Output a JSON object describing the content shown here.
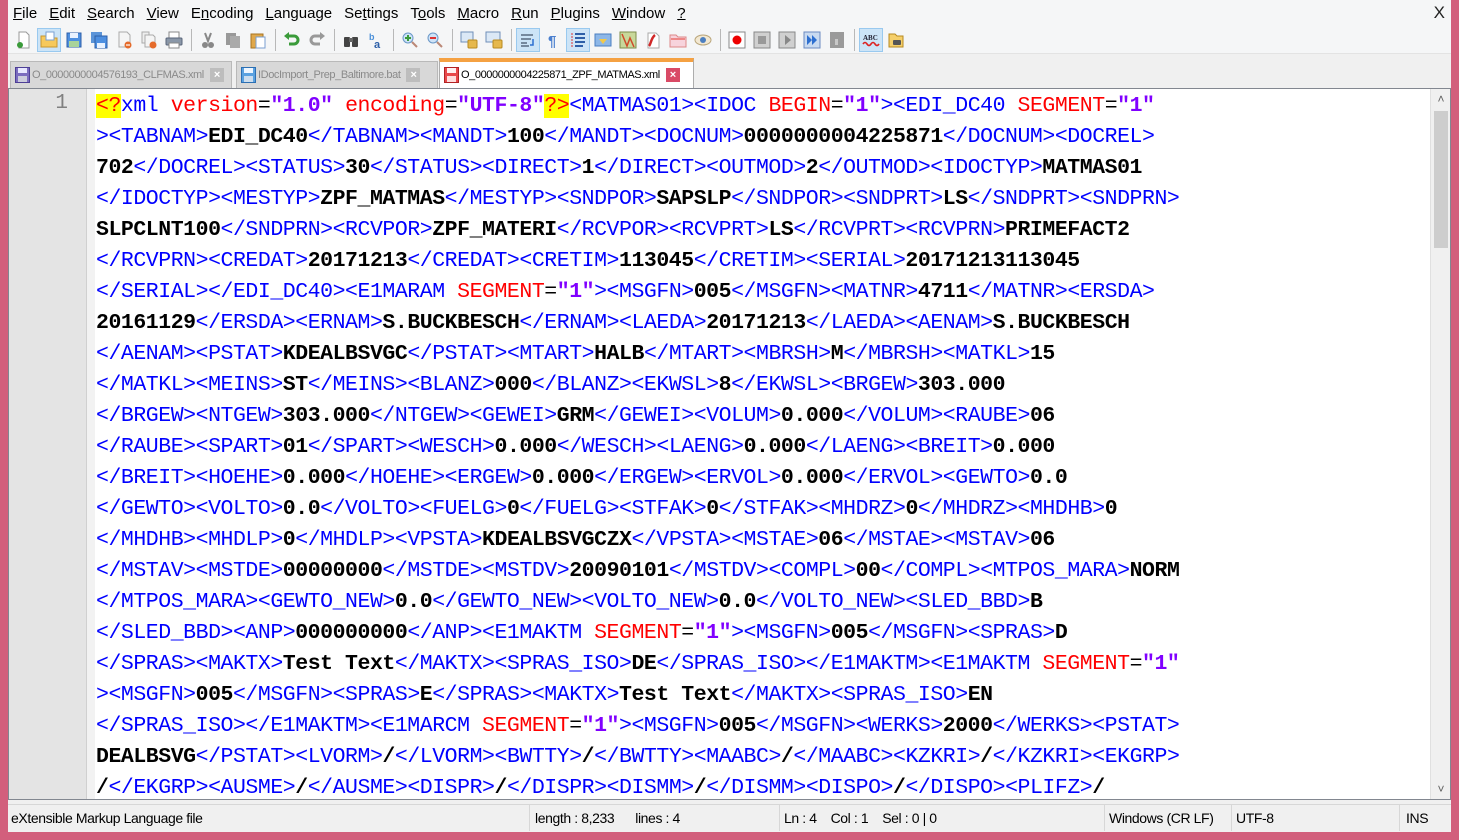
{
  "window": {
    "close_label": "X"
  },
  "menu": [
    {
      "label": "File",
      "accel": "F",
      "rest": "ile"
    },
    {
      "label": "Edit",
      "accel": "E",
      "rest": "dit"
    },
    {
      "label": "Search",
      "accel": "S",
      "rest": "earch"
    },
    {
      "label": "View",
      "accel": "V",
      "rest": "iew"
    },
    {
      "label": "Encoding",
      "pre": "E",
      "accel": "n",
      "rest": "coding"
    },
    {
      "label": "Language",
      "accel": "L",
      "rest": "anguage"
    },
    {
      "label": "Settings",
      "pre": "Se",
      "accel": "t",
      "rest": "tings"
    },
    {
      "label": "Tools",
      "pre": "T",
      "accel": "o",
      "rest": "ols"
    },
    {
      "label": "Macro",
      "accel": "M",
      "rest": "acro"
    },
    {
      "label": "Run",
      "accel": "R",
      "rest": "un"
    },
    {
      "label": "Plugins",
      "accel": "P",
      "rest": "lugins"
    },
    {
      "label": "Window",
      "accel": "W",
      "rest": "indow"
    },
    {
      "label": "?",
      "accel": "?",
      "rest": ""
    }
  ],
  "toolbar": {
    "buttons": [
      {
        "name": "new-file",
        "icon": "new-file-icon"
      },
      {
        "name": "open-file",
        "icon": "open-folder-icon",
        "active": true
      },
      {
        "name": "save",
        "icon": "save-icon"
      },
      {
        "name": "save-all",
        "icon": "save-all-icon"
      },
      {
        "name": "close",
        "icon": "close-file-icon"
      },
      {
        "name": "close-all",
        "icon": "close-all-icon"
      },
      {
        "name": "print",
        "icon": "print-icon"
      },
      {
        "sep": true
      },
      {
        "name": "cut",
        "icon": "cut-icon"
      },
      {
        "name": "copy",
        "icon": "copy-icon"
      },
      {
        "name": "paste",
        "icon": "paste-icon"
      },
      {
        "sep": true
      },
      {
        "name": "undo",
        "icon": "undo-icon"
      },
      {
        "name": "redo",
        "icon": "redo-icon"
      },
      {
        "sep": true
      },
      {
        "name": "find",
        "icon": "binoculars-icon"
      },
      {
        "name": "replace",
        "icon": "replace-icon"
      },
      {
        "sep": true
      },
      {
        "name": "zoom-in",
        "icon": "zoom-in-icon"
      },
      {
        "name": "zoom-out",
        "icon": "zoom-out-icon"
      },
      {
        "sep": true
      },
      {
        "name": "sync-vertical",
        "icon": "sync-vertical-icon"
      },
      {
        "name": "sync-horizontal",
        "icon": "sync-horizontal-icon"
      },
      {
        "sep": true
      },
      {
        "name": "word-wrap",
        "icon": "word-wrap-icon",
        "active": true
      },
      {
        "name": "show-all-chars",
        "icon": "pilcrow-icon"
      },
      {
        "name": "indent-guide",
        "icon": "indent-guide-icon",
        "active": true
      },
      {
        "name": "user-defined-language",
        "icon": "udl-icon"
      },
      {
        "name": "document-map",
        "icon": "document-map-icon"
      },
      {
        "name": "function-list",
        "icon": "function-list-icon"
      },
      {
        "name": "folder-as-workspace",
        "icon": "folder-icon"
      },
      {
        "name": "monitoring",
        "icon": "eye-icon"
      },
      {
        "sep": true
      },
      {
        "name": "record-macro",
        "icon": "record-icon"
      },
      {
        "name": "stop-recording",
        "icon": "stop-icon"
      },
      {
        "name": "play-macro",
        "icon": "play-icon"
      },
      {
        "name": "run-macro-multiple",
        "icon": "fast-forward-icon"
      },
      {
        "name": "save-macro",
        "icon": "save-macro-icon"
      },
      {
        "sep": true
      },
      {
        "name": "spell-check",
        "icon": "spell-check-icon",
        "active": true
      },
      {
        "name": "explorer",
        "icon": "explorer-icon"
      }
    ]
  },
  "tabs": [
    {
      "label": "O_0000000004576193_CLFMAS.xml",
      "active": false,
      "saved": true
    },
    {
      "label": "IDocImport_Prep_Baltimore.bat",
      "active": false,
      "saved": true
    },
    {
      "label": "O_0000000004225871_ZPF_MATMAS.xml",
      "active": true,
      "saved": false
    }
  ],
  "editor": {
    "line_number": "1",
    "lines": [
      [
        [
          "pi",
          "<?"
        ],
        [
          "xmlkw",
          "xml "
        ],
        [
          "attr",
          "version"
        ],
        [
          "eq",
          "="
        ],
        [
          "val",
          "\"1.0\""
        ],
        [
          "xmlkw",
          " "
        ],
        [
          "attr",
          "encoding"
        ],
        [
          "eq",
          "="
        ],
        [
          "val",
          "\"UTF-8\""
        ],
        [
          "pi",
          "?>"
        ],
        [
          "tag",
          "<MATMAS01><IDOC "
        ],
        [
          "attr",
          "BEGIN"
        ],
        [
          "eq",
          "="
        ],
        [
          "val",
          "\"1\""
        ],
        [
          "tag",
          "><EDI_DC40 "
        ],
        [
          "attr",
          "SEGMENT"
        ],
        [
          "eq",
          "="
        ],
        [
          "val",
          "\"1\""
        ]
      ],
      [
        [
          "tag",
          "><TABNAM>"
        ],
        [
          "txt",
          "EDI_DC40"
        ],
        [
          "tag",
          "</TABNAM><MANDT>"
        ],
        [
          "txt",
          "100"
        ],
        [
          "tag",
          "</MANDT><DOCNUM>"
        ],
        [
          "txt",
          "0000000004225871"
        ],
        [
          "tag",
          "</DOCNUM><DOCREL>"
        ]
      ],
      [
        [
          "txt",
          "702"
        ],
        [
          "tag",
          "</DOCREL><STATUS>"
        ],
        [
          "txt",
          "30"
        ],
        [
          "tag",
          "</STATUS><DIRECT>"
        ],
        [
          "txt",
          "1"
        ],
        [
          "tag",
          "</DIRECT><OUTMOD>"
        ],
        [
          "txt",
          "2"
        ],
        [
          "tag",
          "</OUTMOD><IDOCTYP>"
        ],
        [
          "txt",
          "MATMAS01"
        ]
      ],
      [
        [
          "tag",
          "</IDOCTYP><MESTYP>"
        ],
        [
          "txt",
          "ZPF_MATMAS"
        ],
        [
          "tag",
          "</MESTYP><SNDPOR>"
        ],
        [
          "txt",
          "SAPSLP"
        ],
        [
          "tag",
          "</SNDPOR><SNDPRT>"
        ],
        [
          "txt",
          "LS"
        ],
        [
          "tag",
          "</SNDPRT><SNDPRN>"
        ]
      ],
      [
        [
          "txt",
          "SLPCLNT100"
        ],
        [
          "tag",
          "</SNDPRN><RCVPOR>"
        ],
        [
          "txt",
          "ZPF_MATERI"
        ],
        [
          "tag",
          "</RCVPOR><RCVPRT>"
        ],
        [
          "txt",
          "LS"
        ],
        [
          "tag",
          "</RCVPRT><RCVPRN>"
        ],
        [
          "txt",
          "PRIMEFACT2"
        ]
      ],
      [
        [
          "tag",
          "</RCVPRN><CREDAT>"
        ],
        [
          "txt",
          "20171213"
        ],
        [
          "tag",
          "</CREDAT><CRETIM>"
        ],
        [
          "txt",
          "113045"
        ],
        [
          "tag",
          "</CRETIM><SERIAL>"
        ],
        [
          "txt",
          "20171213113045"
        ]
      ],
      [
        [
          "tag",
          "</SERIAL></EDI_DC40><E1MARAM "
        ],
        [
          "attr",
          "SEGMENT"
        ],
        [
          "eq",
          "="
        ],
        [
          "val",
          "\"1\""
        ],
        [
          "tag",
          "><MSGFN>"
        ],
        [
          "txt",
          "005"
        ],
        [
          "tag",
          "</MSGFN><MATNR>"
        ],
        [
          "txt",
          "4711"
        ],
        [
          "tag",
          "</MATNR><ERSDA>"
        ]
      ],
      [
        [
          "txt",
          "20161129"
        ],
        [
          "tag",
          "</ERSDA><ERNAM>"
        ],
        [
          "txt",
          "S.BUCKBESCH"
        ],
        [
          "tag",
          "</ERNAM><LAEDA>"
        ],
        [
          "txt",
          "20171213"
        ],
        [
          "tag",
          "</LAEDA><AENAM>"
        ],
        [
          "txt",
          "S.BUCKBESCH"
        ]
      ],
      [
        [
          "tag",
          "</AENAM><PSTAT>"
        ],
        [
          "txt",
          "KDEALBSVGC"
        ],
        [
          "tag",
          "</PSTAT><MTART>"
        ],
        [
          "txt",
          "HALB"
        ],
        [
          "tag",
          "</MTART><MBRSH>"
        ],
        [
          "txt",
          "M"
        ],
        [
          "tag",
          "</MBRSH><MATKL>"
        ],
        [
          "txt",
          "15"
        ]
      ],
      [
        [
          "tag",
          "</MATKL><MEINS>"
        ],
        [
          "txt",
          "ST"
        ],
        [
          "tag",
          "</MEINS><BLANZ>"
        ],
        [
          "txt",
          "000"
        ],
        [
          "tag",
          "</BLANZ><EKWSL>"
        ],
        [
          "txt",
          "8"
        ],
        [
          "tag",
          "</EKWSL><BRGEW>"
        ],
        [
          "txt",
          "303.000"
        ]
      ],
      [
        [
          "tag",
          "</BRGEW><NTGEW>"
        ],
        [
          "txt",
          "303.000"
        ],
        [
          "tag",
          "</NTGEW><GEWEI>"
        ],
        [
          "txt",
          "GRM"
        ],
        [
          "tag",
          "</GEWEI><VOLUM>"
        ],
        [
          "txt",
          "0.000"
        ],
        [
          "tag",
          "</VOLUM><RAUBE>"
        ],
        [
          "txt",
          "06"
        ]
      ],
      [
        [
          "tag",
          "</RAUBE><SPART>"
        ],
        [
          "txt",
          "01"
        ],
        [
          "tag",
          "</SPART><WESCH>"
        ],
        [
          "txt",
          "0.000"
        ],
        [
          "tag",
          "</WESCH><LAENG>"
        ],
        [
          "txt",
          "0.000"
        ],
        [
          "tag",
          "</LAENG><BREIT>"
        ],
        [
          "txt",
          "0.000"
        ]
      ],
      [
        [
          "tag",
          "</BREIT><HOEHE>"
        ],
        [
          "txt",
          "0.000"
        ],
        [
          "tag",
          "</HOEHE><ERGEW>"
        ],
        [
          "txt",
          "0.000"
        ],
        [
          "tag",
          "</ERGEW><ERVOL>"
        ],
        [
          "txt",
          "0.000"
        ],
        [
          "tag",
          "</ERVOL><GEWTO>"
        ],
        [
          "txt",
          "0.0"
        ]
      ],
      [
        [
          "tag",
          "</GEWTO><VOLTO>"
        ],
        [
          "txt",
          "0.0"
        ],
        [
          "tag",
          "</VOLTO><FUELG>"
        ],
        [
          "txt",
          "0"
        ],
        [
          "tag",
          "</FUELG><STFAK>"
        ],
        [
          "txt",
          "0"
        ],
        [
          "tag",
          "</STFAK><MHDRZ>"
        ],
        [
          "txt",
          "0"
        ],
        [
          "tag",
          "</MHDRZ><MHDHB>"
        ],
        [
          "txt",
          "0"
        ]
      ],
      [
        [
          "tag",
          "</MHDHB><MHDLP>"
        ],
        [
          "txt",
          "0"
        ],
        [
          "tag",
          "</MHDLP><VPSTA>"
        ],
        [
          "txt",
          "KDEALBSVGCZX"
        ],
        [
          "tag",
          "</VPSTA><MSTAE>"
        ],
        [
          "txt",
          "06"
        ],
        [
          "tag",
          "</MSTAE><MSTAV>"
        ],
        [
          "txt",
          "06"
        ]
      ],
      [
        [
          "tag",
          "</MSTAV><MSTDE>"
        ],
        [
          "txt",
          "00000000"
        ],
        [
          "tag",
          "</MSTDE><MSTDV>"
        ],
        [
          "txt",
          "20090101"
        ],
        [
          "tag",
          "</MSTDV><COMPL>"
        ],
        [
          "txt",
          "00"
        ],
        [
          "tag",
          "</COMPL><MTPOS_MARA>"
        ],
        [
          "txt",
          "NORM"
        ]
      ],
      [
        [
          "tag",
          "</MTPOS_MARA><GEWTO_NEW>"
        ],
        [
          "txt",
          "0.0"
        ],
        [
          "tag",
          "</GEWTO_NEW><VOLTO_NEW>"
        ],
        [
          "txt",
          "0.0"
        ],
        [
          "tag",
          "</VOLTO_NEW><SLED_BBD>"
        ],
        [
          "txt",
          "B"
        ]
      ],
      [
        [
          "tag",
          "</SLED_BBD><ANP>"
        ],
        [
          "txt",
          "000000000"
        ],
        [
          "tag",
          "</ANP><E1MAKTM "
        ],
        [
          "attr",
          "SEGMENT"
        ],
        [
          "eq",
          "="
        ],
        [
          "val",
          "\"1\""
        ],
        [
          "tag",
          "><MSGFN>"
        ],
        [
          "txt",
          "005"
        ],
        [
          "tag",
          "</MSGFN><SPRAS>"
        ],
        [
          "txt",
          "D"
        ]
      ],
      [
        [
          "tag",
          "</SPRAS><MAKTX>"
        ],
        [
          "txt",
          "Test Text"
        ],
        [
          "tag",
          "</MAKTX><SPRAS_ISO>"
        ],
        [
          "txt",
          "DE"
        ],
        [
          "tag",
          "</SPRAS_ISO></E1MAKTM><E1MAKTM "
        ],
        [
          "attr",
          "SEGMENT"
        ],
        [
          "eq",
          "="
        ],
        [
          "val",
          "\"1\""
        ]
      ],
      [
        [
          "tag",
          "><MSGFN>"
        ],
        [
          "txt",
          "005"
        ],
        [
          "tag",
          "</MSGFN><SPRAS>"
        ],
        [
          "txt",
          "E"
        ],
        [
          "tag",
          "</SPRAS><MAKTX>"
        ],
        [
          "txt",
          "Test Text"
        ],
        [
          "tag",
          "</MAKTX><SPRAS_ISO>"
        ],
        [
          "txt",
          "EN"
        ]
      ],
      [
        [
          "tag",
          "</SPRAS_ISO></E1MAKTM><E1MARCM "
        ],
        [
          "attr",
          "SEGMENT"
        ],
        [
          "eq",
          "="
        ],
        [
          "val",
          "\"1\""
        ],
        [
          "tag",
          "><MSGFN>"
        ],
        [
          "txt",
          "005"
        ],
        [
          "tag",
          "</MSGFN><WERKS>"
        ],
        [
          "txt",
          "2000"
        ],
        [
          "tag",
          "</WERKS><PSTAT>"
        ]
      ],
      [
        [
          "txt",
          "DEALBSVG"
        ],
        [
          "tag",
          "</PSTAT><LVORM>"
        ],
        [
          "txt",
          "/"
        ],
        [
          "tag",
          "</LVORM><BWTTY>"
        ],
        [
          "txt",
          "/"
        ],
        [
          "tag",
          "</BWTTY><MAABC>"
        ],
        [
          "txt",
          "/"
        ],
        [
          "tag",
          "</MAABC><KZKRI>"
        ],
        [
          "txt",
          "/"
        ],
        [
          "tag",
          "</KZKRI><EKGRP>"
        ]
      ],
      [
        [
          "txt",
          "/"
        ],
        [
          "tag",
          "</EKGRP><AUSME>"
        ],
        [
          "txt",
          "/"
        ],
        [
          "tag",
          "</AUSME><DISPR>"
        ],
        [
          "txt",
          "/"
        ],
        [
          "tag",
          "</DISPR><DISMM>"
        ],
        [
          "txt",
          "/"
        ],
        [
          "tag",
          "</DISMM><DISPO>"
        ],
        [
          "txt",
          "/"
        ],
        [
          "tag",
          "</DISPO><PLIFZ>"
        ],
        [
          "txt",
          "/"
        ]
      ]
    ]
  },
  "scrollbar": {
    "up": "^",
    "down": "v"
  },
  "status": {
    "file_type": "eXtensible Markup Language file",
    "length": "length : 8,233",
    "lines": "lines : 4",
    "position": "Ln : 4    Col : 1    Sel : 0 | 0",
    "eol": "Windows (CR LF)",
    "encoding": "UTF-8",
    "mode": "INS"
  }
}
